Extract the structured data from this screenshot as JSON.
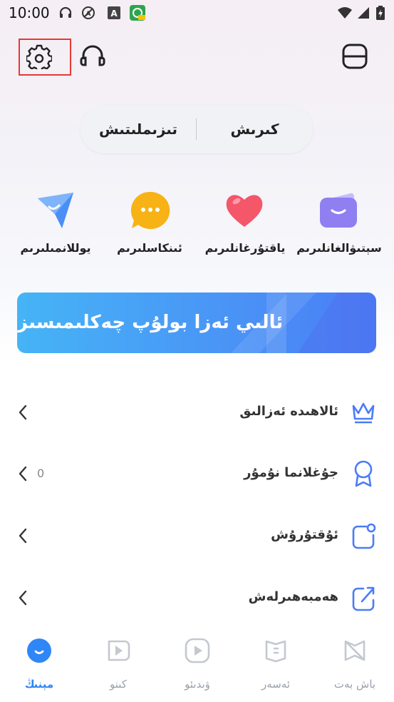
{
  "status_bar": {
    "time": "10:00",
    "icons": [
      "headphones-icon",
      "no-dnd-icon",
      "a-icon",
      "app-notification-icon",
      "wifi-icon",
      "signal-icon",
      "battery-icon"
    ]
  },
  "header": {
    "settings_icon": "gear-icon",
    "support_icon": "headset-icon",
    "scan_icon": "scan-icon"
  },
  "auth_pill": {
    "login": "كىرىش",
    "register": "تىزىملىتىش"
  },
  "shortcuts": [
    {
      "label": "سېتىۋالغانلىرىم",
      "icon": "wallet-icon",
      "color": "#8f7ff0"
    },
    {
      "label": "ياقتۇرغانلىرىم",
      "icon": "heart-icon",
      "color": "#f4566a"
    },
    {
      "label": "ئىنكاسلىرىم",
      "icon": "chat-icon",
      "color": "#f7b215"
    },
    {
      "label": "يوللانمىلىرىم",
      "icon": "send-icon",
      "color": "#4a8ff5"
    }
  ],
  "banner": {
    "text": "ئالىي ئەزا بولۇپ چەكلىمىسىز ئىشلىتىڭ"
  },
  "menu": [
    {
      "label": "ئالاھىدە ئەزالىق",
      "icon": "crown-icon",
      "count": ""
    },
    {
      "label": "جۇغلانما نۇمۇر",
      "icon": "medal-icon",
      "count": "0"
    },
    {
      "label": "ئۇقتۇرۇش",
      "icon": "notification-icon",
      "count": ""
    },
    {
      "label": "ھەمبەھىرلەش",
      "icon": "share-icon",
      "count": ""
    }
  ],
  "bottom_nav": [
    {
      "label": "باش بەت",
      "icon": "home-icon",
      "active": false
    },
    {
      "label": "ئەسەر",
      "icon": "book-icon",
      "active": false
    },
    {
      "label": "ۋىدىئو",
      "icon": "video-icon",
      "active": false
    },
    {
      "label": "كىنو",
      "icon": "movie-icon",
      "active": false
    },
    {
      "label": "مېنىڭ",
      "icon": "profile-icon",
      "active": true
    }
  ],
  "colors": {
    "accent": "#2f86f6",
    "nav_inactive": "#9aa0aa",
    "settings_highlight": "#e53935"
  }
}
